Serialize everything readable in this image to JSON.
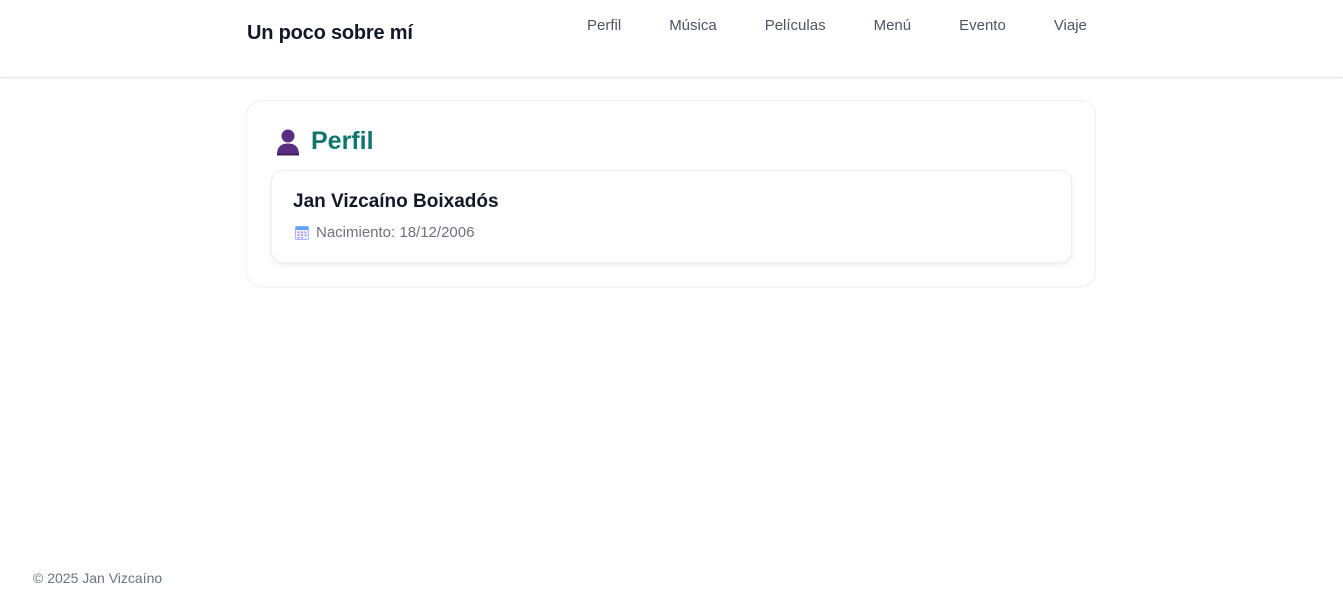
{
  "header": {
    "brand": "Un poco sobre mí",
    "nav": [
      "Perfil",
      "Música",
      "Películas",
      "Menú",
      "Evento",
      "Viaje"
    ]
  },
  "section": {
    "title": "Perfil",
    "icon": "person-icon"
  },
  "profile": {
    "name": "Jan Vizcaíno Boixadós",
    "birth_icon": "calendar-icon",
    "birth_text": "Nacimiento: 18/12/2006"
  },
  "footer": {
    "text": "© 2025 Jan Vizcaíno"
  },
  "colors": {
    "accent": "#0f766e",
    "icon_purple": "#5b2d82"
  }
}
